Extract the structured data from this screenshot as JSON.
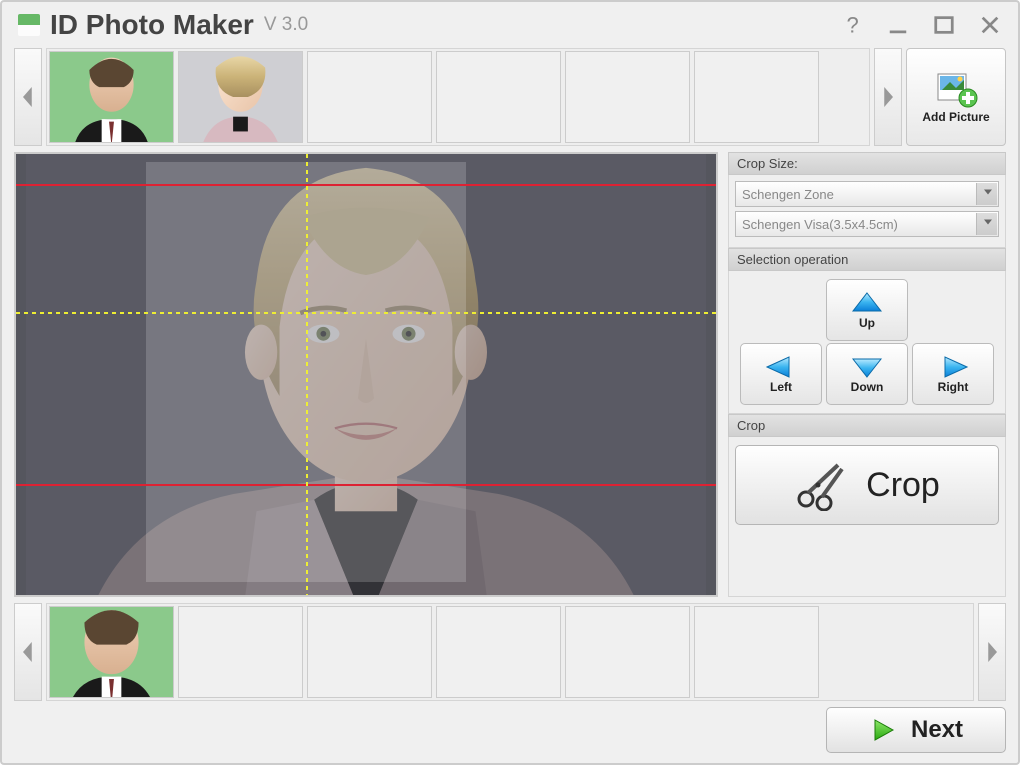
{
  "titlebar": {
    "app_name": "ID Photo Maker",
    "version": "V 3.0"
  },
  "thumbstrip_top": {
    "slots": 6,
    "add_label": "Add Picture"
  },
  "thumbstrip_bottom": {
    "slots": 6
  },
  "sidepanel": {
    "crop_size_label": "Crop Size:",
    "zone_combo": "Schengen Zone",
    "format_combo": "Schengen Visa(3.5x4.5cm)",
    "sel_op_label": "Selection operation",
    "up": "Up",
    "down": "Down",
    "left": "Left",
    "right": "Right",
    "crop_section_label": "Crop",
    "crop_button": "Crop"
  },
  "footer": {
    "next": "Next"
  }
}
